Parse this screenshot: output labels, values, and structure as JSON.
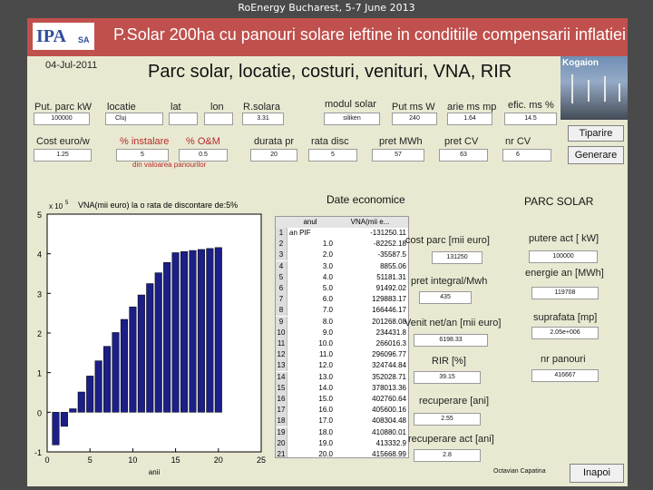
{
  "slide_caption": "RoEnergy Bucharest, 5-7 June 2013",
  "logo": {
    "mark": "IPA",
    "sub": "SA"
  },
  "app_title": "P.Solar 200ha cu panouri solare ieftine in conditiile compensarii inflatiei",
  "date": "04-Jul-2011",
  "heading": "Parc solar, locatie, costuri,  venituri, VNA, RIR",
  "photo_label": "Kogaion",
  "params_row1": [
    {
      "label": "Put. parc kW",
      "value": "100000"
    },
    {
      "label": "locatie",
      "value": "Cluj"
    },
    {
      "label": "lat",
      "value": ""
    },
    {
      "label": "lon",
      "value": ""
    },
    {
      "label": "R.solara",
      "value": "3.31"
    },
    {
      "label": "modul solar",
      "value": "siliken"
    },
    {
      "label": "Put ms W",
      "value": "240"
    },
    {
      "label": "arie ms mp",
      "value": "1.64"
    },
    {
      "label": "efic. ms %",
      "value": "14.5"
    }
  ],
  "params_row2": [
    {
      "label": "Cost euro/w",
      "value": "1.25"
    },
    {
      "label": "% instalare",
      "value": "5"
    },
    {
      "label": "% O&M",
      "value": "0.5"
    },
    {
      "label": "durata pr",
      "value": "20"
    },
    {
      "label": "rata disc",
      "value": "5"
    },
    {
      "label": "pret MWh",
      "value": "57"
    },
    {
      "label": "pret CV",
      "value": "63"
    },
    {
      "label": "nr CV",
      "value": "6"
    }
  ],
  "note": "din valoarea panourilor",
  "buttons": {
    "print": "Tiparire",
    "generate": "Generare",
    "back": "Inapoi"
  },
  "sections": {
    "economic": "Date economice",
    "park": "PARC SOLAR"
  },
  "chart_data": {
    "type": "bar",
    "title": "VNA(mii euro) la o rata de discontare de:5%",
    "exponent_label": "x 10",
    "exponent_power": "5",
    "xlabel": "anii",
    "ylabel": "",
    "xlim": [
      0,
      25
    ],
    "ylim": [
      -1,
      5
    ],
    "xticks": [
      "0",
      "5",
      "10",
      "15",
      "20",
      "25"
    ],
    "yticks": [
      "-1",
      "0",
      "1",
      "2",
      "3",
      "4",
      "5"
    ],
    "x": [
      1,
      2,
      3,
      4,
      5,
      6,
      7,
      8,
      9,
      10,
      11,
      12,
      13,
      14,
      15,
      16,
      17,
      18,
      19,
      20
    ],
    "values": [
      -0.8225,
      -0.3559,
      0.0886,
      0.5118,
      0.9149,
      1.2988,
      1.6645,
      2.0127,
      2.3443,
      2.6602,
      2.961,
      3.2474,
      3.5203,
      3.7801,
      4.0276,
      4.056,
      4.083,
      4.1088,
      4.1333,
      4.1567
    ],
    "bar_color": "#1b1f86",
    "grid": false
  },
  "table": {
    "headers": [
      "anul",
      "VNA(mii e..."
    ],
    "rows": [
      [
        "1",
        "an PIF",
        "-131250.11"
      ],
      [
        "2",
        "1.0",
        "-82252.18"
      ],
      [
        "3",
        "2.0",
        "-35587.5"
      ],
      [
        "4",
        "3.0",
        "8855.06"
      ],
      [
        "5",
        "4.0",
        "51181.31"
      ],
      [
        "6",
        "5.0",
        "91492.02"
      ],
      [
        "7",
        "6.0",
        "129883.17"
      ],
      [
        "8",
        "7.0",
        "166446.17"
      ],
      [
        "9",
        "8.0",
        "201268.08"
      ],
      [
        "10",
        "9.0",
        "234431.8"
      ],
      [
        "11",
        "10.0",
        "266016.3"
      ],
      [
        "12",
        "11.0",
        "296096.77"
      ],
      [
        "13",
        "12.0",
        "324744.84"
      ],
      [
        "14",
        "13.0",
        "352028.71"
      ],
      [
        "15",
        "14.0",
        "378013.36"
      ],
      [
        "16",
        "15.0",
        "402760.64"
      ],
      [
        "17",
        "16.0",
        "405600.16"
      ],
      [
        "18",
        "17.0",
        "408304.48"
      ],
      [
        "19",
        "18.0",
        "410880.01"
      ],
      [
        "20",
        "19.0",
        "413332.9"
      ],
      [
        "21",
        "20.0",
        "415668.99"
      ]
    ]
  },
  "economic_fields": [
    {
      "label": "cost parc [mii euro]",
      "value": "131250"
    },
    {
      "label": "pret integral/Mwh",
      "value": "435"
    },
    {
      "label": "Venit net/an [mii euro]",
      "value": "6198.33"
    },
    {
      "label": "RIR [%]",
      "value": "39.15"
    },
    {
      "label": "recuperare [ani]",
      "value": "2.55"
    },
    {
      "label": "recuperare act [ani]",
      "value": "2.8"
    }
  ],
  "park_fields": [
    {
      "label": "putere act [ kW]",
      "value": "100000"
    },
    {
      "label": "energie an [MWh]",
      "value": "119708"
    },
    {
      "label": "suprafata [mp]",
      "value": "2.05e+006"
    },
    {
      "label": "nr panouri",
      "value": "416667"
    }
  ],
  "author": "Octavian Capatina"
}
